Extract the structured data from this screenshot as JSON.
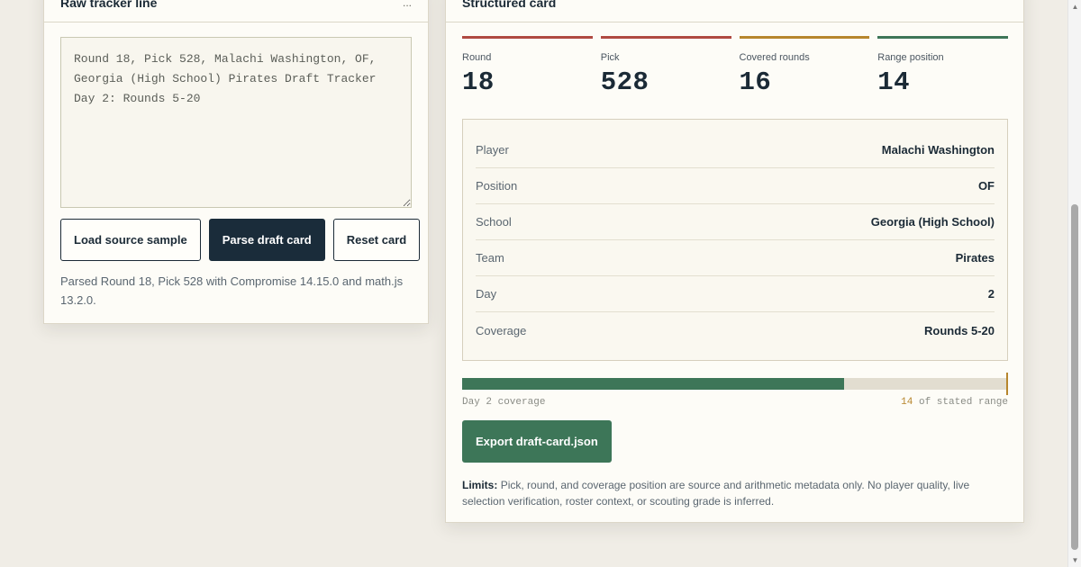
{
  "left_panel": {
    "title": "Raw tracker line",
    "meta": "...",
    "raw_text": "Round 18, Pick 528, Malachi Washington, OF, Georgia (High School) Pirates Draft Tracker Day 2: Rounds 5-20",
    "buttons": {
      "load": "Load source sample",
      "parse": "Parse draft card",
      "reset": "Reset card"
    },
    "status": "Parsed Round 18, Pick 528 with Compromise 14.15.0 and math.js 13.2.0."
  },
  "right_panel": {
    "title": "Structured card",
    "stats": [
      {
        "label": "Round",
        "value": "18",
        "color": "#b04a42"
      },
      {
        "label": "Pick",
        "value": "528",
        "color": "#b04a42"
      },
      {
        "label": "Covered rounds",
        "value": "16",
        "color": "#b7862d"
      },
      {
        "label": "Range position",
        "value": "14",
        "color": "#3d7658"
      }
    ],
    "details": [
      {
        "label": "Player",
        "value": "Malachi Washington"
      },
      {
        "label": "Position",
        "value": "OF"
      },
      {
        "label": "School",
        "value": "Georgia (High School)"
      },
      {
        "label": "Team",
        "value": "Pirates"
      },
      {
        "label": "Day",
        "value": "2"
      },
      {
        "label": "Coverage",
        "value": "Rounds 5-20"
      }
    ],
    "coverage": {
      "label": "Day 2 coverage",
      "range_value": "14",
      "range_suffix": "of stated range",
      "fill_fraction": 0.7
    },
    "export_label": "Export draft-card.json",
    "limits_label": "Limits:",
    "limits_text": "Pick, round, and coverage position are source and arithmetic metadata only. No player quality, live selection verification, roster context, or scouting grade is inferred."
  },
  "colors": {
    "navy": "#1a2c3a",
    "green": "#3d7658",
    "red": "#b04a42",
    "gold": "#b7862d",
    "background": "#f0ede6"
  }
}
